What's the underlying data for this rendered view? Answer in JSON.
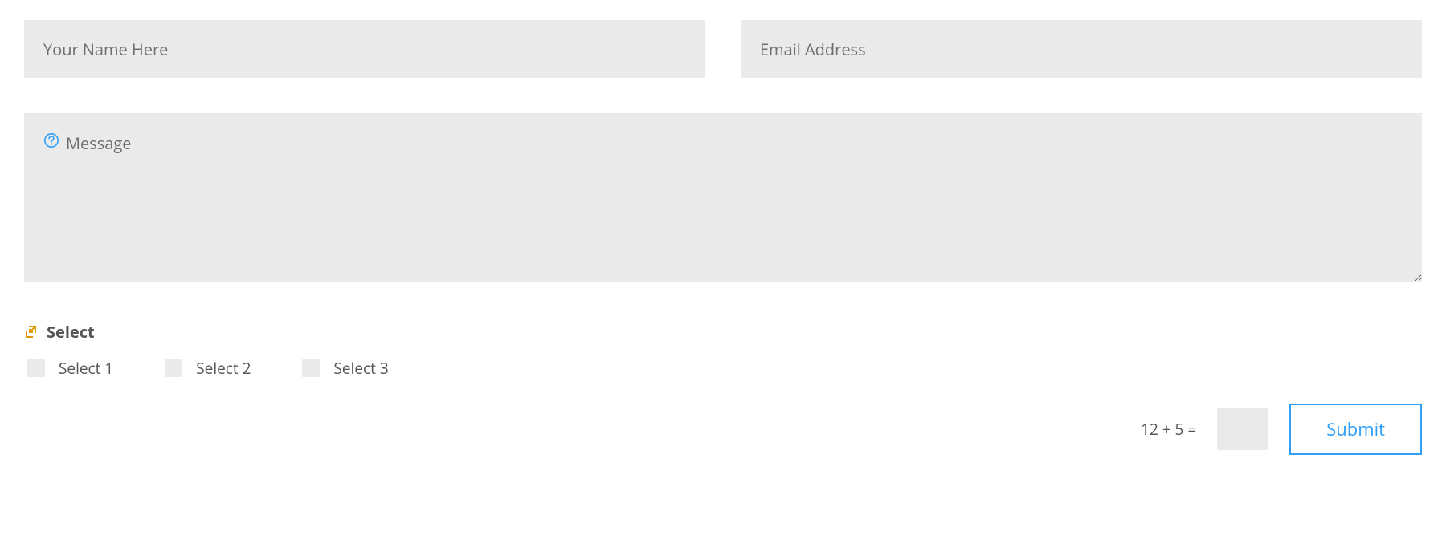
{
  "form": {
    "name": {
      "placeholder": "Your Name Here",
      "value": ""
    },
    "email": {
      "placeholder": "Email Address",
      "value": ""
    },
    "message": {
      "placeholder": "Message",
      "value": ""
    },
    "select": {
      "title": "Select",
      "options": [
        {
          "label": "Select 1",
          "checked": false
        },
        {
          "label": "Select 2",
          "checked": false
        },
        {
          "label": "Select 3",
          "checked": false
        }
      ]
    },
    "captcha": {
      "question": "12 + 5 =",
      "value": ""
    },
    "submit_label": "Submit"
  },
  "colors": {
    "accent": "#2e9ef7",
    "field_bg": "#eaeaea",
    "icon_orange": "#e09900",
    "help_icon": "#2e9ef7"
  }
}
